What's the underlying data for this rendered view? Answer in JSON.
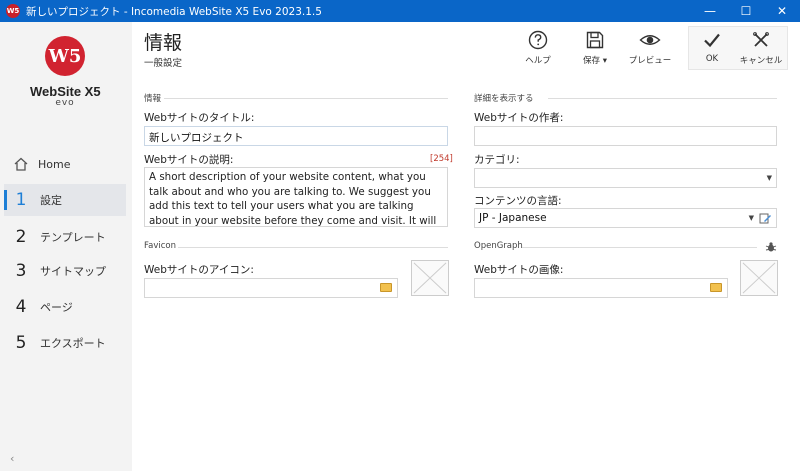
{
  "window": {
    "title": "新しいプロジェクト - Incomedia WebSite X5 Evo 2023.1.5",
    "app_icon_text": "W5",
    "controls": {
      "minimize": "—",
      "maximize": "☐",
      "close": "✕"
    }
  },
  "sidebar": {
    "logo": {
      "mark": "W5",
      "name": "WebSite X5",
      "edition": "evo"
    },
    "home_label": "Home",
    "items": [
      {
        "num": "1",
        "label": "設定",
        "active": true
      },
      {
        "num": "2",
        "label": "テンプレート",
        "active": false
      },
      {
        "num": "3",
        "label": "サイトマップ",
        "active": false
      },
      {
        "num": "4",
        "label": "ページ",
        "active": false
      },
      {
        "num": "5",
        "label": "エクスポート",
        "active": false
      }
    ],
    "collapse_glyph": "‹"
  },
  "header": {
    "title": "情報",
    "subtitle": "一般設定",
    "toolbar": {
      "help": "ヘルプ",
      "save": "保存 ▾",
      "preview": "プレビュー",
      "ok": "OK",
      "cancel": "キャンセル"
    }
  },
  "left": {
    "section_info": "情報",
    "title_label": "Webサイトのタイトル:",
    "title_value": "新しいプロジェクト",
    "desc_label": "Webサイトの説明:",
    "desc_counter": "[254]",
    "desc_value": "A short description of your website content, what you talk about and who you are talking to. We suggest you add  this text to tell your users what you are talking about in your website before they come and visit. It will be amongst search engine results.",
    "section_favicon": "Favicon",
    "icon_label": "Webサイトのアイコン:",
    "icon_value": ""
  },
  "right": {
    "section_details": "詳細を表示する",
    "author_label": "Webサイトの作者:",
    "author_value": "",
    "category_label": "カテゴリ:",
    "category_value": "",
    "language_label": "コンテンツの言語:",
    "language_value": "JP - Japanese",
    "section_opengraph": "OpenGraph",
    "image_label": "Webサイトの画像:",
    "image_value": ""
  }
}
